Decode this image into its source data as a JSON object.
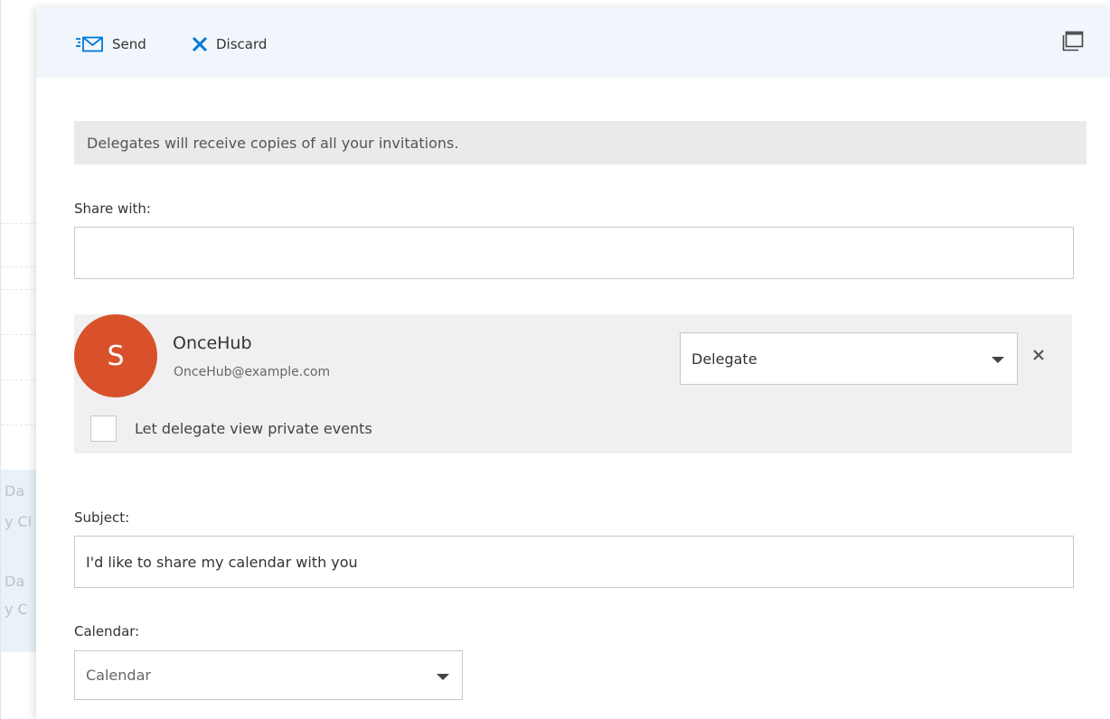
{
  "toolbar": {
    "send_label": "Send",
    "discard_label": "Discard",
    "send_icon": "send-mail-icon",
    "discard_icon": "close-x-icon",
    "popout_icon": "pop-out-window-icon",
    "accent_color": "#0078d7"
  },
  "background": {
    "snippets": [
      "Da",
      "y Cl",
      "Da",
      "y C"
    ]
  },
  "info_message": "Delegates will receive copies of all your invitations.",
  "share_with": {
    "label": "Share with:",
    "value": "",
    "placeholder": ""
  },
  "delegate": {
    "avatar_initial": "S",
    "avatar_color": "#d8512b",
    "name": "OnceHub",
    "email": "OnceHub@example.com",
    "role": "Delegate",
    "private_events_label": "Let delegate view private events",
    "private_events_checked": false
  },
  "subject": {
    "label": "Subject:",
    "value": "I'd like to share my calendar with you"
  },
  "calendar": {
    "label": "Calendar:",
    "selected": "Calendar"
  }
}
